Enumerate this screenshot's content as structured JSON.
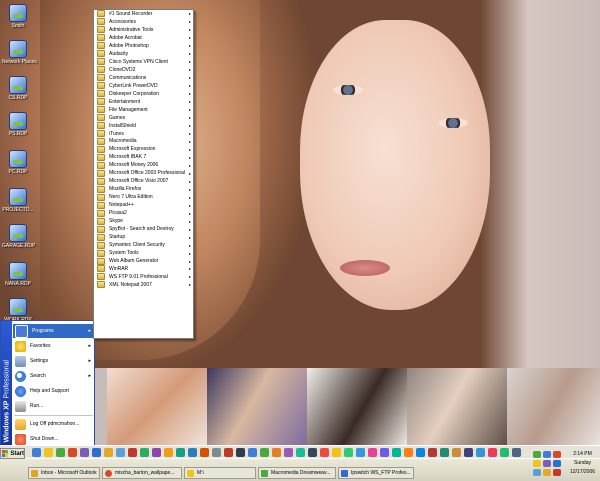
{
  "desktop": {
    "icons": [
      {
        "label": "Smith"
      },
      {
        "label": "Network Places"
      },
      {
        "label": "CS.RDP"
      },
      {
        "label": "PS.RDP"
      },
      {
        "label": "PC.RDP"
      },
      {
        "label": "PROJECTO..."
      },
      {
        "label": "GARAGE.RDP"
      },
      {
        "label": "NANA.RDP"
      },
      {
        "label": "WORK.RDP"
      }
    ]
  },
  "start_menu": {
    "banner_prefix": "Windows XP",
    "banner_suffix": "Professional",
    "items": [
      {
        "label": "Programs",
        "arrow": "▸",
        "icon": "programs-icon",
        "color": "#4a7bd4"
      },
      {
        "label": "Favorites",
        "arrow": "▸",
        "icon": "favorites-icon",
        "color": "#f0c419"
      },
      {
        "label": "Settings",
        "arrow": "▸",
        "icon": "settings-icon",
        "color": "#6f8fb8"
      },
      {
        "label": "Search",
        "arrow": "▸",
        "icon": "search-icon",
        "color": "#3d7fd9"
      },
      {
        "label": "Help and Support",
        "arrow": "",
        "icon": "help-icon",
        "color": "#2b6dd1"
      },
      {
        "label": "Run...",
        "arrow": "",
        "icon": "run-icon",
        "color": "#8b8b8b"
      },
      {
        "label": "Log Off pdmcmahon...",
        "arrow": "",
        "icon": "log-off-icon",
        "color": "#e3a824"
      },
      {
        "label": "Shut Down...",
        "arrow": "",
        "icon": "shut-down-icon",
        "color": "#d84a26"
      }
    ]
  },
  "programs_menu": {
    "items": [
      "#1 Sound Recorder",
      "Accessories",
      "Administrative Tools",
      "Adobe Acrobat",
      "Adobe Photoshop",
      "Audacity",
      "Cisco Systems VPN Client",
      "CloneDVD2",
      "Communications",
      "CyberLink PowerDVD",
      "Diskeeper Corporation",
      "Entertainment",
      "File Management",
      "Games",
      "InstallShield",
      "iTunes",
      "Macromedia",
      "Microsoft Expression",
      "Microsoft IBAK 7",
      "Microsoft Money 2006",
      "Microsoft Office 2003 Professional",
      "Microsoft Office Visio 2007",
      "Mozilla Firefox",
      "Nero 7 Ultra Edition",
      "Notepad++",
      "Picasa2",
      "Skype",
      "SpyBot - Search and Destroy",
      "Startup",
      "Symantec Client Security",
      "System Tools",
      "Web Album Generator",
      "WinRAR",
      "WS FTP 9.01 Professional",
      "XML Notepad 2007"
    ],
    "arrow": "▸"
  },
  "taskbar": {
    "start_label": "Start",
    "tasks": [
      {
        "label": "Inbox - Microsoft Outlook",
        "color": "#e0a526"
      },
      {
        "label": "mischa_barton_wallpape...",
        "color": "#d84a26"
      },
      {
        "label": "M:\\",
        "color": "#f0c419"
      },
      {
        "label": "Macromedia Dreamweav...",
        "color": "#4caa3d"
      },
      {
        "label": "Ipswitch WS_FTP Profes...",
        "color": "#2b6dd1"
      }
    ],
    "clock": {
      "time": "2:14 PM",
      "day": "Sunday",
      "date": "12/17/2006"
    }
  }
}
